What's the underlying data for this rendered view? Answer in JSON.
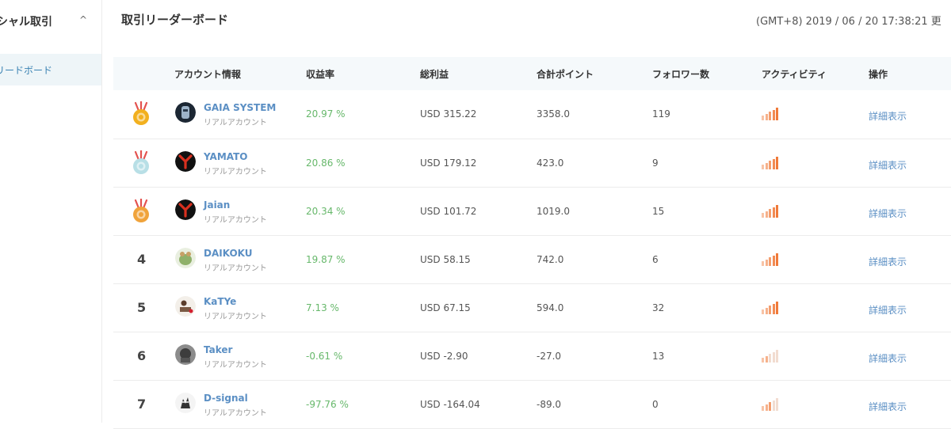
{
  "sidebar": {
    "section_label": "シャル取引",
    "chevron_glyph": "^",
    "items": [
      {
        "label": "リードボード"
      }
    ]
  },
  "page": {
    "title": "取引リーダーボード",
    "timestamp": "(GMT+8) 2019 / 06 / 20 17:38:21 更"
  },
  "table": {
    "headers": [
      "アカウント情報",
      "収益率",
      "総利益",
      "合計ポイント",
      "フォロワー数",
      "アクティビティ",
      "操作"
    ],
    "rows": [
      {
        "rank": "",
        "medal": "gold",
        "name": "GAIA SYSTEM",
        "account_type": "リアルアカウント",
        "return": "20.97 %",
        "profit": "USD 315.22",
        "points": "3358.0",
        "followers": "119",
        "activity_level": 5,
        "action": "詳細表示"
      },
      {
        "rank": "",
        "medal": "silver",
        "name": "YAMATO",
        "account_type": "リアルアカウント",
        "return": "20.86 %",
        "profit": "USD 179.12",
        "points": "423.0",
        "followers": "9",
        "activity_level": 5,
        "action": "詳細表示"
      },
      {
        "rank": "",
        "medal": "bronze",
        "name": "Jaian",
        "account_type": "リアルアカウント",
        "return": "20.34 %",
        "profit": "USD 101.72",
        "points": "1019.0",
        "followers": "15",
        "activity_level": 5,
        "action": "詳細表示"
      },
      {
        "rank": "4",
        "medal": "",
        "name": "DAIKOKU",
        "account_type": "リアルアカウント",
        "return": "19.87 %",
        "profit": "USD 58.15",
        "points": "742.0",
        "followers": "6",
        "activity_level": 5,
        "action": "詳細表示"
      },
      {
        "rank": "5",
        "medal": "",
        "name": "KaTYe",
        "account_type": "リアルアカウント",
        "return": "7.13 %",
        "profit": "USD 67.15",
        "points": "594.0",
        "followers": "32",
        "activity_level": 5,
        "action": "詳細表示"
      },
      {
        "rank": "6",
        "medal": "",
        "name": "Taker",
        "account_type": "リアルアカウント",
        "return": "-0.61 %",
        "profit": "USD -2.90",
        "points": "-27.0",
        "followers": "13",
        "activity_level": 2,
        "action": "詳細表示"
      },
      {
        "rank": "7",
        "medal": "",
        "name": "D-signal",
        "account_type": "リアルアカウント",
        "return": "-97.76 %",
        "profit": "USD -164.04",
        "points": "-89.0",
        "followers": "0",
        "activity_level": 3,
        "action": "詳細表示"
      }
    ]
  },
  "colors": {
    "accent_blue": "#5b8fc4",
    "profit_green": "#67b86b",
    "activity_on": "#f07a3a",
    "activity_off": "#f2dcd0",
    "gold": "#f2b01e",
    "silver": "#b8dfe6",
    "bronze": "#f0a33b"
  },
  "avatars": [
    "mecha-avatar",
    "y-logo-avatar",
    "y-logo-avatar",
    "frog-avatar",
    "desk-avatar",
    "gorilla-avatar",
    "mecha-avatar-2"
  ]
}
